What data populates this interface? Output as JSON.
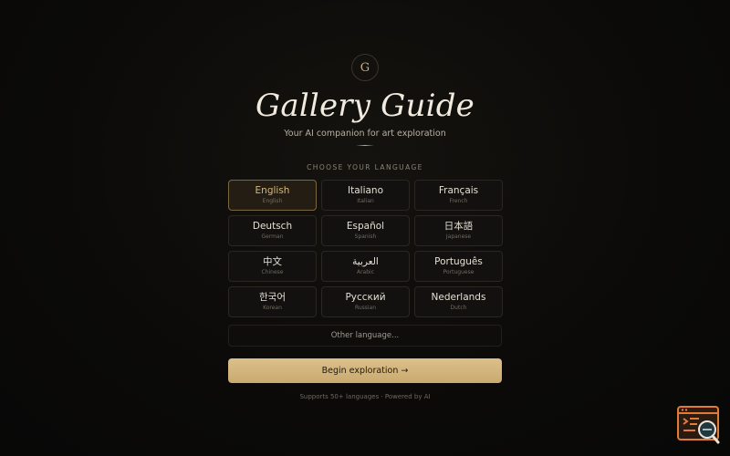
{
  "app": {
    "logo_letter": "G",
    "title": "Gallery Guide",
    "subtitle": "Your AI companion for art exploration"
  },
  "language_section": {
    "label": "CHOOSE YOUR LANGUAGE",
    "selected": "English",
    "languages": [
      {
        "native": "English",
        "english": "English"
      },
      {
        "native": "Italiano",
        "english": "Italian"
      },
      {
        "native": "Français",
        "english": "French"
      },
      {
        "native": "Deutsch",
        "english": "German"
      },
      {
        "native": "Español",
        "english": "Spanish"
      },
      {
        "native": "日本語",
        "english": "Japanese"
      },
      {
        "native": "中文",
        "english": "Chinese"
      },
      {
        "native": "العربية",
        "english": "Arabic"
      },
      {
        "native": "Português",
        "english": "Portuguese"
      },
      {
        "native": "한국어",
        "english": "Korean"
      },
      {
        "native": "Русский",
        "english": "Russian"
      },
      {
        "native": "Nederlands",
        "english": "Dutch"
      }
    ],
    "other_label": "Other language..."
  },
  "actions": {
    "begin_label": "Begin exploration →"
  },
  "footer": {
    "text": "Supports 50+ languages · Powered by AI"
  },
  "colors": {
    "accent": "#c9ad77",
    "background": "#0b0a09",
    "corner_widget": "#e07b39"
  },
  "icons": {
    "corner_widget": "code-search-icon"
  }
}
